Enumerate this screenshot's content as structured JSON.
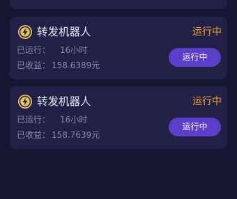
{
  "robots": [
    {
      "name": "转发机器人",
      "status": "运行中",
      "runtime_label": "已运行：",
      "runtime_value": "16小时",
      "earnings_label": "已收益：",
      "earnings_value": "158.6389元",
      "button_label": "运行中"
    },
    {
      "name": "转发机器人",
      "status": "运行中",
      "runtime_label": "已运行：",
      "runtime_value": "16小时",
      "earnings_label": "已收益：",
      "earnings_value": "158.7639元",
      "button_label": "运行中"
    }
  ],
  "icon": "lightning-bolt-icon",
  "colors": {
    "background": "#161633",
    "card": "#222046",
    "status": "#f2a23a",
    "button": "#5b3fc8",
    "icon_fill": "#e8c45e"
  }
}
